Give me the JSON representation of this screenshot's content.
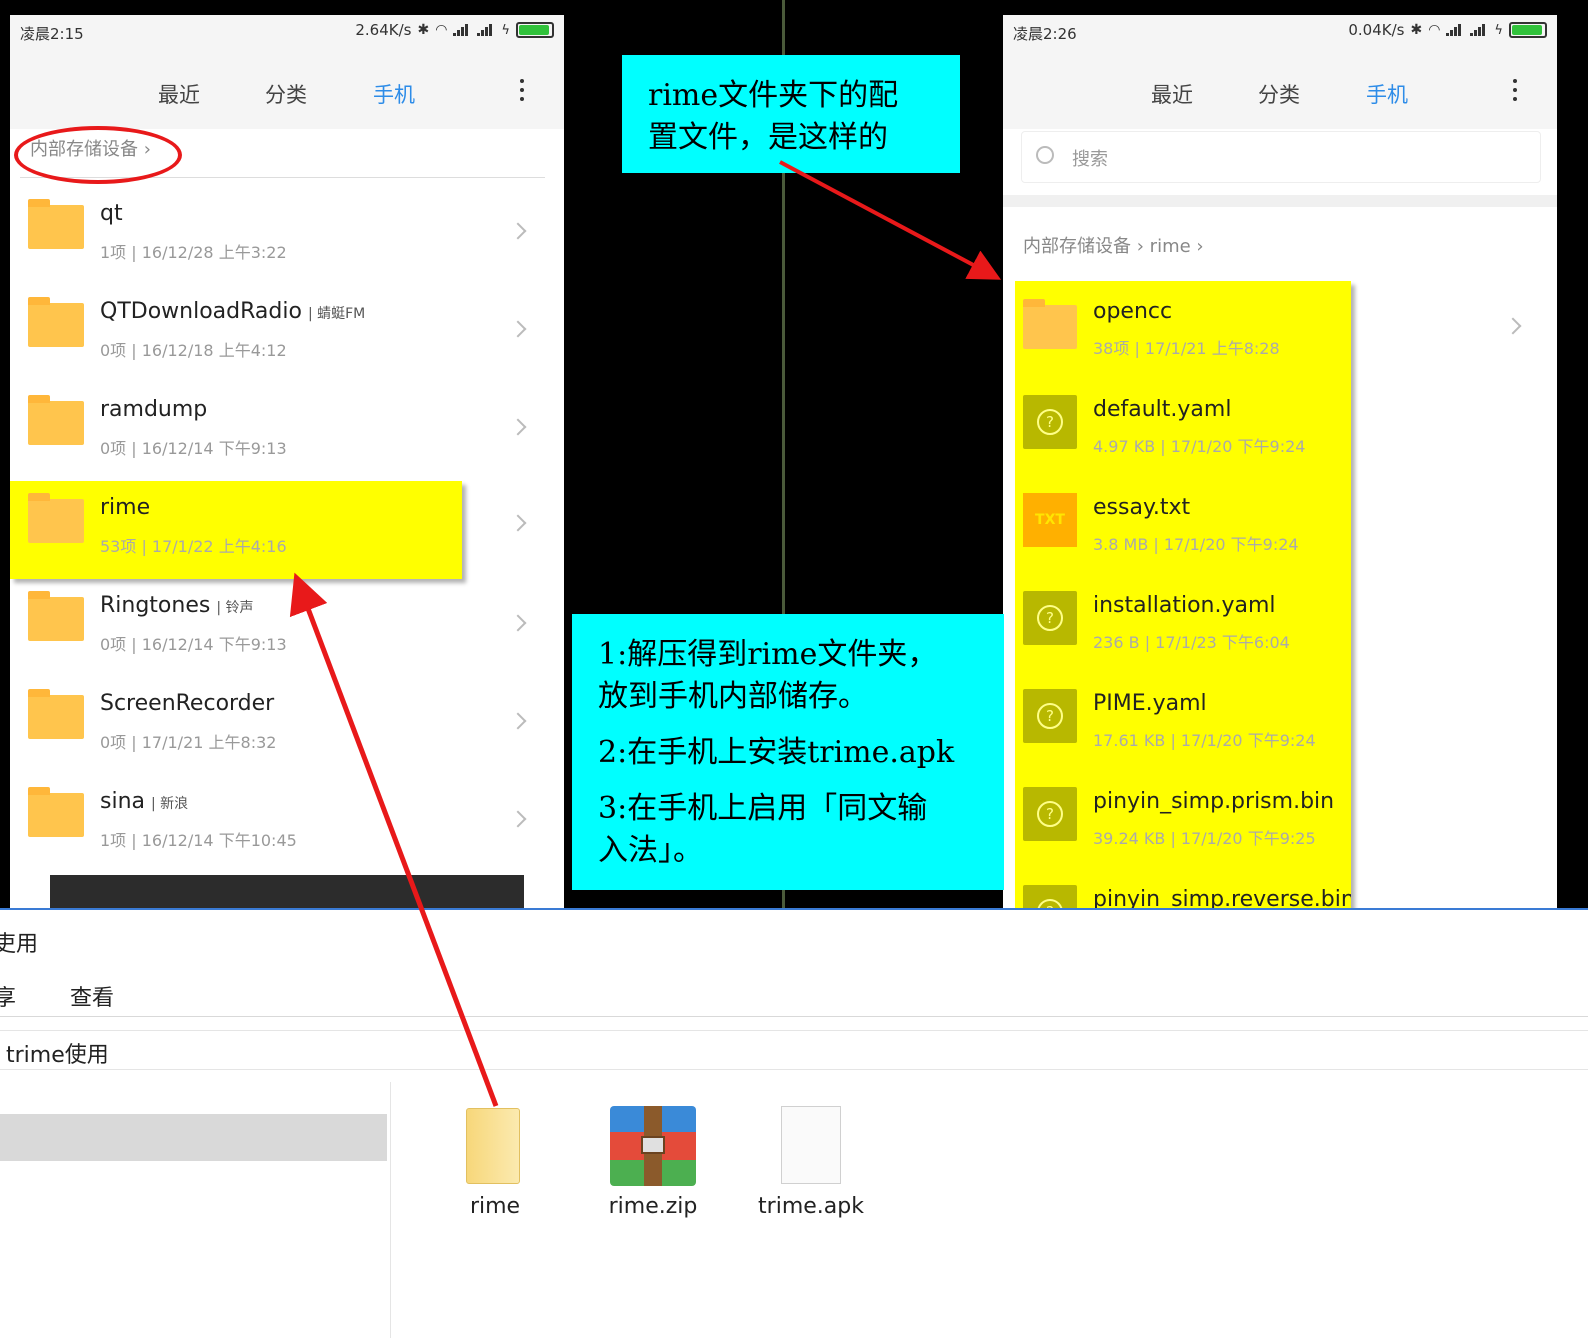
{
  "left_phone": {
    "status": {
      "time": "凌晨2:15",
      "speed": "2.64K/s"
    },
    "tabs": [
      "最近",
      "分类",
      "手机"
    ],
    "breadcrumb": "内部存储设备",
    "rows": [
      {
        "name": "qt",
        "tag": "",
        "meta": "1项 | 16/12/28 上午3:22"
      },
      {
        "name": "QTDownloadRadio",
        "tag": "蜻蜓FM",
        "meta": "0项 | 16/12/18 上午4:12"
      },
      {
        "name": "ramdump",
        "tag": "",
        "meta": "0项 | 16/12/14 下午9:13"
      },
      {
        "name": "rime",
        "tag": "",
        "meta": "53项 | 17/1/22 上午4:16"
      },
      {
        "name": "Ringtones",
        "tag": "铃声",
        "meta": "0项 | 16/12/14 下午9:13"
      },
      {
        "name": "ScreenRecorder",
        "tag": "",
        "meta": "0项 | 17/1/21 上午8:32"
      },
      {
        "name": "sina",
        "tag": "新浪",
        "meta": "1项 | 16/12/14 下午10:45"
      }
    ]
  },
  "right_phone": {
    "status": {
      "time": "凌晨2:26",
      "speed": "0.04K/s"
    },
    "tabs": [
      "最近",
      "分类",
      "手机"
    ],
    "search_placeholder": "搜索",
    "breadcrumb": [
      "内部存储设备",
      "rime"
    ],
    "rows": [
      {
        "name": "opencc",
        "type": "folder",
        "meta": "38项 | 17/1/21 上午8:28"
      },
      {
        "name": "default.yaml",
        "type": "unknown",
        "meta": "4.97 KB | 17/1/20 下午9:24"
      },
      {
        "name": "essay.txt",
        "type": "txt",
        "icon_label": "TXT",
        "meta": "3.8 MB | 17/1/20 下午9:24"
      },
      {
        "name": "installation.yaml",
        "type": "unknown",
        "meta": "236 B | 17/1/23 下午6:04"
      },
      {
        "name": "PIME.yaml",
        "type": "unknown",
        "meta": "17.61 KB | 17/1/20 下午9:24"
      },
      {
        "name": "pinyin_simp.prism.bin",
        "type": "unknown",
        "meta": "39.24 KB | 17/1/20 下午9:25"
      },
      {
        "name": "pinyin_simp.reverse.bin",
        "type": "unknown",
        "meta": ""
      }
    ]
  },
  "callouts": {
    "top": [
      "rime文件夹下的配",
      "置文件，是这样的"
    ],
    "steps": [
      "1:解压得到rime文件夹，",
      "放到手机内部储存。",
      "2:在手机上安装trime.apk",
      "3:在手机上启用「同文输",
      "入法」。"
    ]
  },
  "explorer": {
    "title_fragment": "吏用",
    "ribbon": [
      "享",
      "查看"
    ],
    "address": "trime使用",
    "files": [
      {
        "name": "rime",
        "icon": "folder-icon"
      },
      {
        "name": "rime.zip",
        "icon": "winrar-archive-icon"
      },
      {
        "name": "trime.apk",
        "icon": "blank-file-icon"
      }
    ]
  },
  "colors": {
    "highlight": "#ffff00",
    "callout": "#00ffff",
    "arrow": "#e8191a",
    "active_tab": "#2d8ce8",
    "folder": "#ffc54d"
  }
}
